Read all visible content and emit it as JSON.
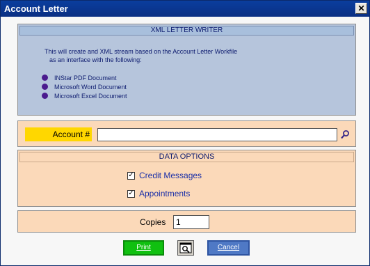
{
  "window": {
    "title": "Account Letter",
    "close_label": "✕"
  },
  "info": {
    "header": "XML LETTER WRITER",
    "line1": "This will create and XML stream based on the Account Letter Workfile",
    "line2": "as an interface with the following:",
    "bullets": [
      "INStar PDF Document",
      "Microsoft Word Document",
      "Microsoft Excel Document"
    ]
  },
  "account": {
    "label": "Account #",
    "value": "",
    "placeholder": ""
  },
  "options": {
    "header": "DATA OPTIONS",
    "credit_messages": {
      "label": "Credit Messages",
      "checked": true
    },
    "appointments": {
      "label": "Appointments",
      "checked": true
    }
  },
  "copies": {
    "label": "Copies",
    "value": "1"
  },
  "buttons": {
    "print": "Print",
    "cancel": "Cancel"
  },
  "colors": {
    "title_bar": "#0a3e9e",
    "panel_blue": "#b6c5dc",
    "panel_peach": "#fbd9b9",
    "account_label_bg": "#ffd700",
    "print_green": "#10c010",
    "cancel_blue": "#4f79c5"
  }
}
